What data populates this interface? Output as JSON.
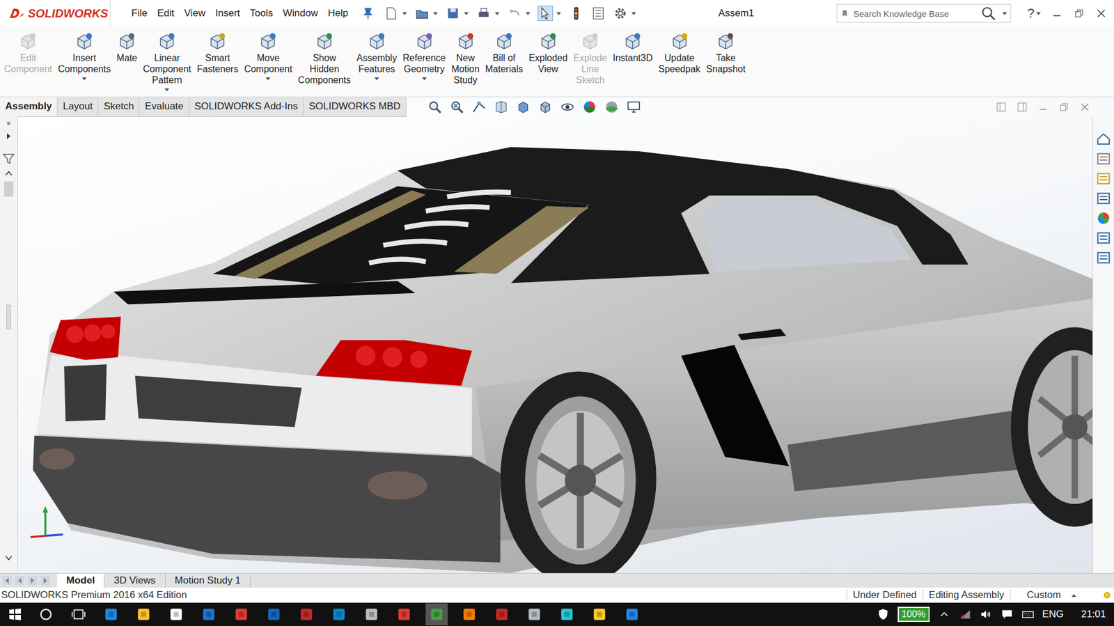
{
  "window": {
    "title": "Assem1"
  },
  "logo": "SOLIDWORKS",
  "menu": [
    "File",
    "Edit",
    "View",
    "Insert",
    "Tools",
    "Window",
    "Help"
  ],
  "search": {
    "placeholder": "Search Knowledge Base"
  },
  "help": "?",
  "ribbon": [
    {
      "label": "Edit Component",
      "disabled": true,
      "dropdown": false
    },
    {
      "label": "Insert Components",
      "disabled": false,
      "dropdown": true
    },
    {
      "label": "Mate",
      "disabled": false,
      "dropdown": false
    },
    {
      "label": "Linear Component Pattern",
      "disabled": false,
      "dropdown": true
    },
    {
      "label": "Smart Fasteners",
      "disabled": false,
      "dropdown": false
    },
    {
      "label": "Move Component",
      "disabled": false,
      "dropdown": true
    },
    {
      "label": "Show Hidden Components",
      "disabled": false,
      "dropdown": false
    },
    {
      "label": "Assembly Features",
      "disabled": false,
      "dropdown": true
    },
    {
      "label": "Reference Geometry",
      "disabled": false,
      "dropdown": true
    },
    {
      "label": "New Motion Study",
      "disabled": false,
      "dropdown": false
    },
    {
      "label": "Bill of Materials",
      "disabled": false,
      "dropdown": false
    },
    {
      "label": "Exploded View",
      "disabled": false,
      "dropdown": false
    },
    {
      "label": "Explode Line Sketch",
      "disabled": true,
      "dropdown": false
    },
    {
      "label": "Instant3D",
      "disabled": false,
      "dropdown": false
    },
    {
      "label": "Update Speedpak",
      "disabled": false,
      "dropdown": false
    },
    {
      "label": "Take Snapshot",
      "disabled": false,
      "dropdown": false
    }
  ],
  "tabs": [
    {
      "label": "Assembly",
      "selected": true
    },
    {
      "label": "Layout",
      "selected": false
    },
    {
      "label": "Sketch",
      "selected": false
    },
    {
      "label": "Evaluate",
      "selected": false
    },
    {
      "label": "SOLIDWORKS Add-Ins",
      "selected": false
    },
    {
      "label": "SOLIDWORKS MBD",
      "selected": false
    }
  ],
  "bottom_tabs": [
    {
      "label": "Model",
      "selected": true
    },
    {
      "label": "3D Views",
      "selected": false
    },
    {
      "label": "Motion Study 1",
      "selected": false
    }
  ],
  "status_bar": {
    "edition": "SOLIDWORKS Premium 2016 x64 Edition",
    "state": "Under Defined",
    "mode": "Editing Assembly",
    "units": "Custom"
  },
  "taskbar": {
    "battery": "100%",
    "language": "ENG",
    "time": "21:01"
  }
}
